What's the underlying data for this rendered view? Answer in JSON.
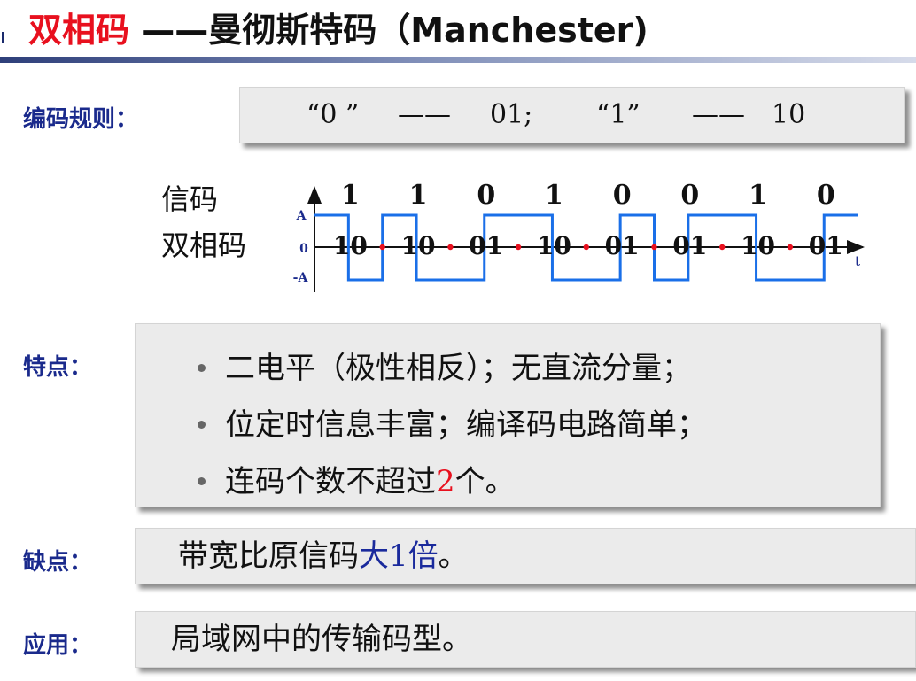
{
  "title": {
    "main": "双相码",
    "sub": "——曼彻斯特码（Manchester)"
  },
  "encoding_rule": {
    "label": "编码规则：",
    "zero_quote": "“0 ”",
    "dash1": "——",
    "zero_code": "01;",
    "one_quote": "“1”",
    "dash2": "——",
    "one_code": "10"
  },
  "waveform": {
    "row1_label": "信码",
    "row2_label": "双相码",
    "axis_top": "A",
    "axis_zero": "0",
    "axis_bottom": "-A",
    "axis_t": "t",
    "bits": [
      "1",
      "1",
      "0",
      "1",
      "0",
      "0",
      "1",
      "0"
    ],
    "codes": [
      "10",
      "10",
      "01",
      "10",
      "01",
      "01",
      "10",
      "01"
    ],
    "signal_color": "#1a6fe8",
    "dot_color": "#e8101e"
  },
  "features": {
    "label": "特点：",
    "items": [
      "二电平（极性相反）；无直流分量；",
      "位定时信息丰富；编译码电路简单；"
    ],
    "item3_prefix": "连码个数不超过",
    "item3_number": "2",
    "item3_suffix": "个。"
  },
  "drawback": {
    "label": "缺点：",
    "prefix": "带宽比原信码",
    "highlight": "大1倍",
    "suffix": "。"
  },
  "application": {
    "label": "应用：",
    "text": "局域网中的传输码型。"
  },
  "colors": {
    "title_red": "#e8101e",
    "label_blue": "#1a2a8c",
    "box_gray": "#ebebeb",
    "highlight_blue": "#1a2a9c"
  }
}
